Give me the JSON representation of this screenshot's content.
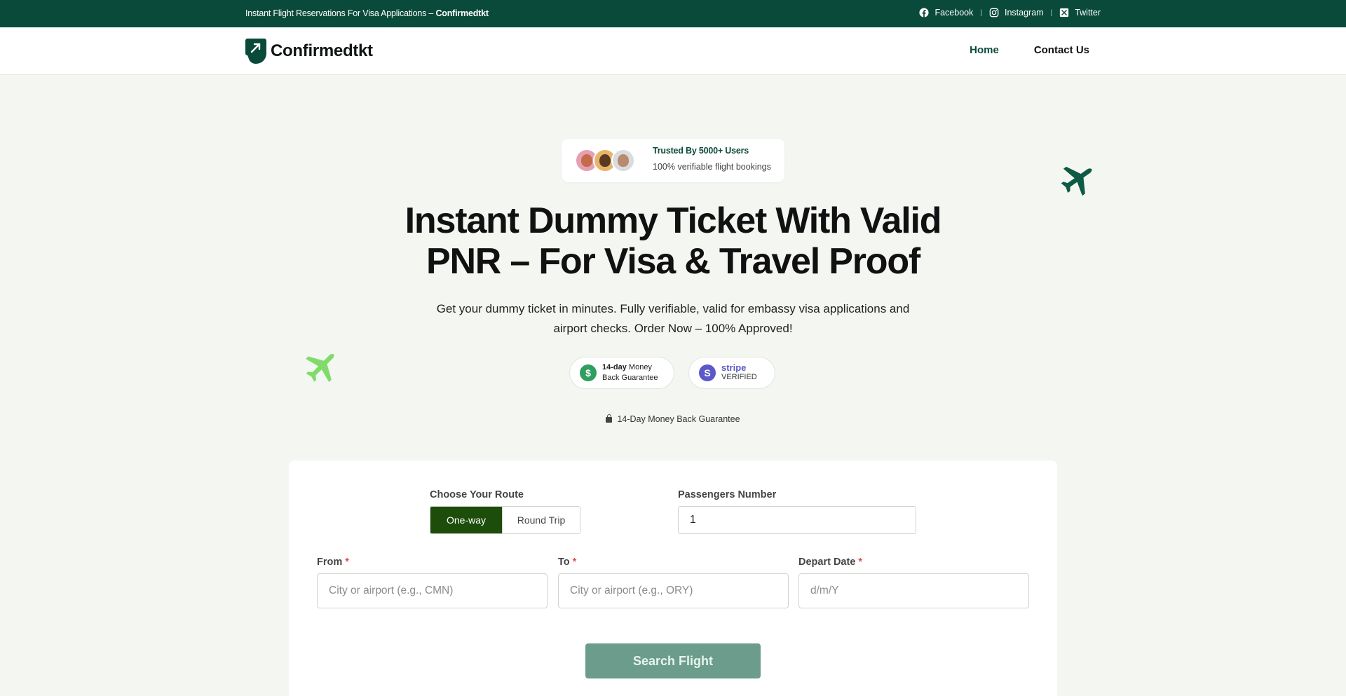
{
  "topbar": {
    "tagline_prefix": "Instant Flight Reservations For Visa Applications – ",
    "tagline_brand": "Confirmedtkt",
    "social": [
      {
        "label": "Facebook",
        "icon": "facebook-icon"
      },
      {
        "label": "Instagram",
        "icon": "instagram-icon"
      },
      {
        "label": "Twitter",
        "icon": "x-twitter-icon"
      }
    ],
    "separator": "|"
  },
  "header": {
    "brand": "Confirmedtkt",
    "nav": [
      {
        "label": "Home",
        "active": true
      },
      {
        "label": "Contact Us",
        "active": false
      }
    ]
  },
  "trust": {
    "title": "Trusted By 5000+ Users",
    "subtitle": "100% verifiable flight bookings"
  },
  "hero": {
    "title": "Instant Dummy Ticket With Valid PNR – For Visa & Travel Proof",
    "subtitle": "Get your dummy ticket in minutes. Fully verifiable, valid for embassy visa applications and airport checks. Order Now – 100% Approved!"
  },
  "badges": {
    "money_back_strong": "14-day",
    "money_back_rest": " Money",
    "money_back_line2": "Back Guarantee",
    "money_icon": "$",
    "stripe_icon": "S",
    "stripe_word": "stripe",
    "stripe_verified": "VERIFIED"
  },
  "guarantee_line": "14-Day Money Back Guarantee",
  "form": {
    "route_label": "Choose Your Route",
    "route_options": [
      "One-way",
      "Round Trip"
    ],
    "route_selected": "One-way",
    "passengers_label": "Passengers Number",
    "passengers_value": "1",
    "from_label": "From",
    "from_placeholder": "City or airport (e.g., CMN)",
    "to_label": "To",
    "to_placeholder": "City or airport (e.g., ORY)",
    "date_label": "Depart Date",
    "date_placeholder": "d/m/Y",
    "required_mark": "*",
    "submit_label": "Search Flight"
  },
  "colors": {
    "topbar": "#0a4a3a",
    "brand_dark": "#0a4a3a",
    "toggle_active": "#1d4d0a",
    "submit_button": "#6c9c8c",
    "plane_light": "#7fdc6a",
    "required": "#e34b4b"
  }
}
